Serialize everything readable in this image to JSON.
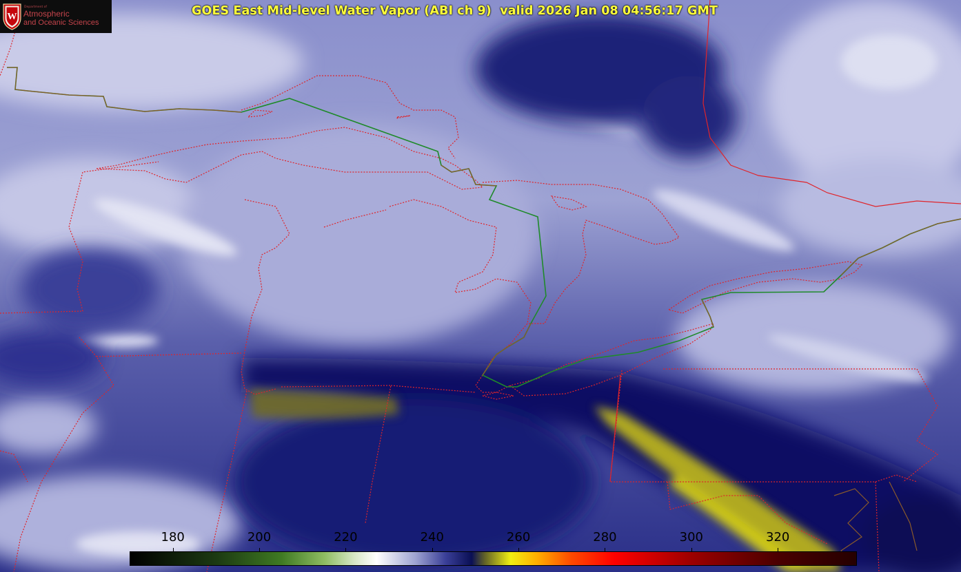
{
  "logo": {
    "seal_letter": "W",
    "department_line": "Department of",
    "name_line1": "Atmospheric",
    "name_line2": "and Oceanic Sciences"
  },
  "title": "GOES East Mid-level Water Vapor (ABI ch 9)  valid 2026 Jan 08 04:56:17 GMT",
  "colorbar": {
    "ticks": [
      "180",
      "200",
      "220",
      "240",
      "260",
      "280",
      "300",
      "320"
    ],
    "range": [
      170,
      338
    ],
    "stops": [
      {
        "value": 170,
        "color": "#000000"
      },
      {
        "value": 190,
        "color": "#1c3a12"
      },
      {
        "value": 205,
        "color": "#3f7a23"
      },
      {
        "value": 215,
        "color": "#8fbd63"
      },
      {
        "value": 222,
        "color": "#d8e8c8"
      },
      {
        "value": 227,
        "color": "#ffffff"
      },
      {
        "value": 236,
        "color": "#9ea3d1"
      },
      {
        "value": 243,
        "color": "#3a3f98"
      },
      {
        "value": 249,
        "color": "#0a0f55"
      },
      {
        "value": 252,
        "color": "#616128"
      },
      {
        "value": 258,
        "color": "#f0ee12"
      },
      {
        "value": 264,
        "color": "#ffb000"
      },
      {
        "value": 272,
        "color": "#ff4a00"
      },
      {
        "value": 282,
        "color": "#ff0000"
      },
      {
        "value": 300,
        "color": "#9c0000"
      },
      {
        "value": 320,
        "color": "#4a0000"
      },
      {
        "value": 338,
        "color": "#250000"
      }
    ]
  },
  "colors": {
    "state_border": "#e0242a",
    "coastline_dotted": "#e0242a",
    "international_border": "#1f8a2a",
    "title_text": "#ffff3a"
  }
}
